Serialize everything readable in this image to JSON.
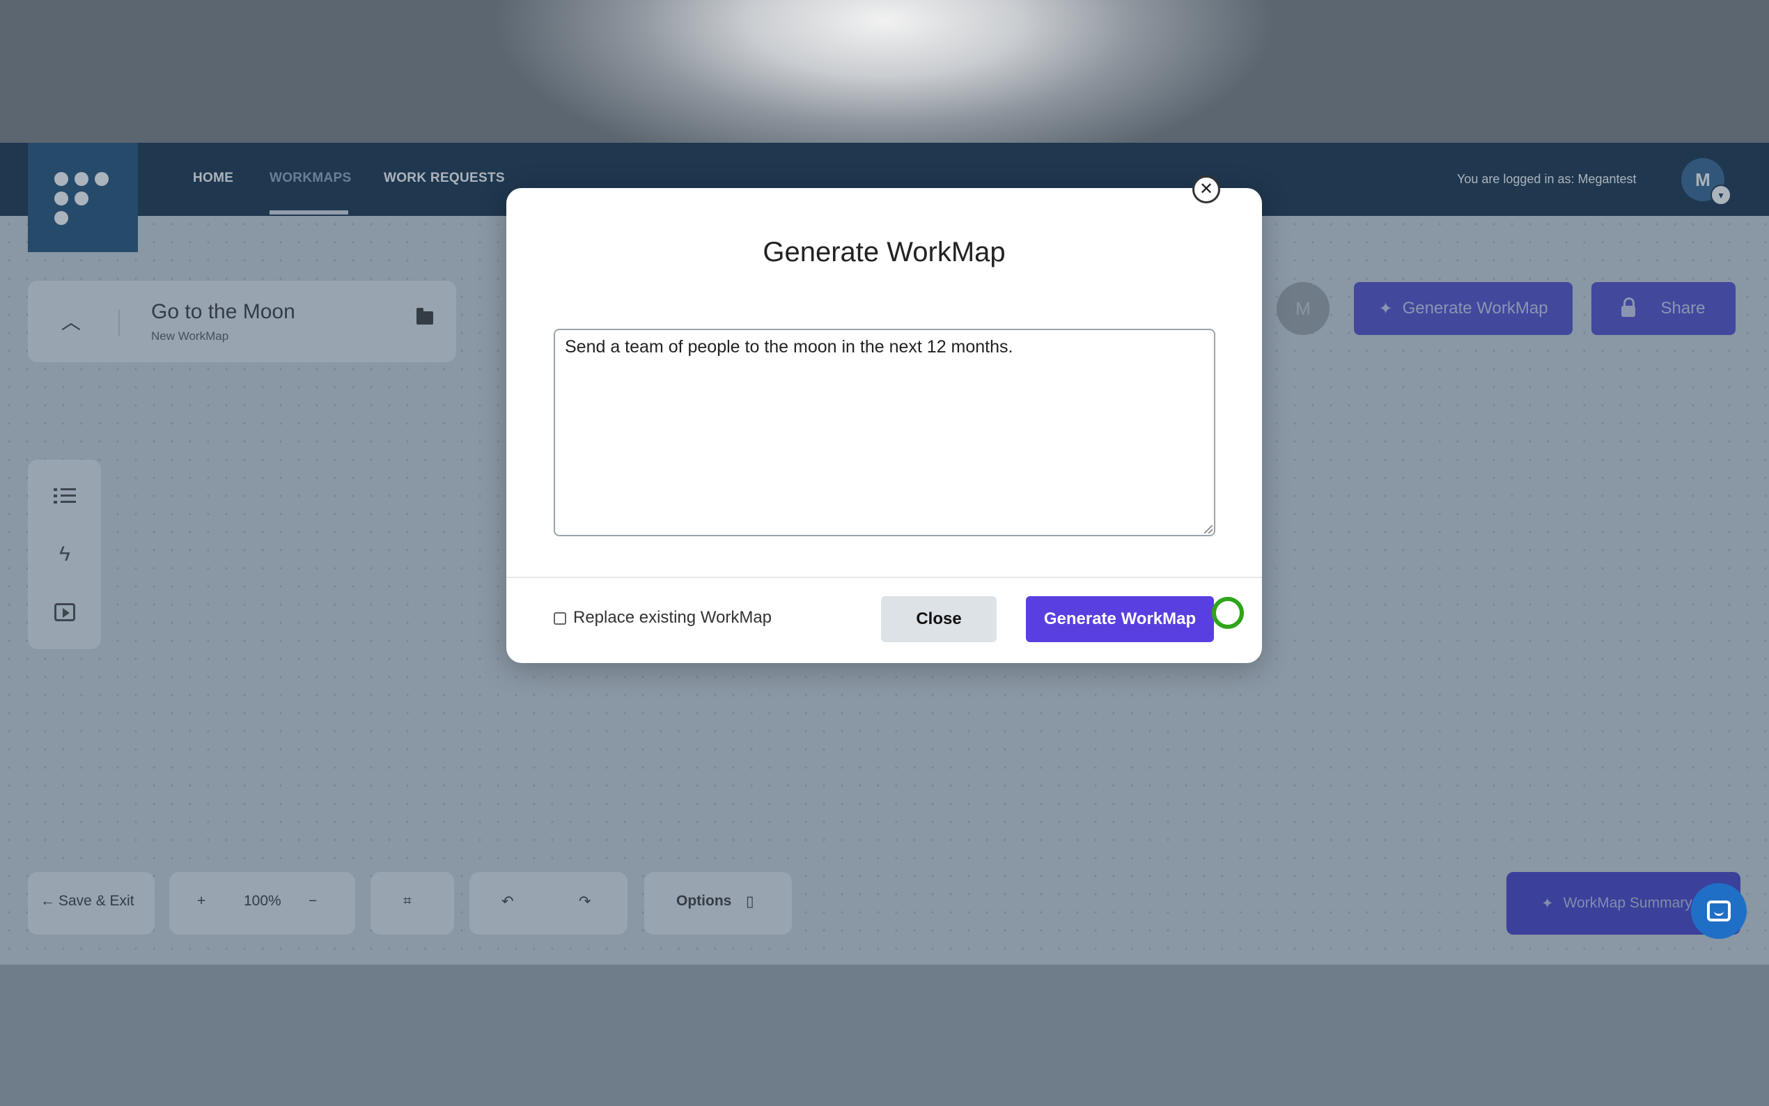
{
  "navbar": {
    "links": [
      "HOME",
      "WORKMAPS",
      "WORK REQUESTS"
    ],
    "login_text": "You are logged in as: Megantest",
    "avatar_initial": "M"
  },
  "workmap": {
    "title": "Go to the Moon",
    "subtitle": "New WorkMap"
  },
  "header_actions": {
    "collaborator_initial": "M",
    "generate_label": "Generate WorkMap",
    "share_label": "Share"
  },
  "bottom_toolbar": {
    "save_exit_label": "Save & Exit",
    "zoom_in": "+",
    "zoom_level": "100%",
    "zoom_out": "−",
    "options_label": "Options",
    "summary_label": "WorkMap Summary"
  },
  "modal": {
    "title": "Generate WorkMap",
    "prompt_value": "Send a team of people to the moon in the next 12 months.",
    "replace_label": "Replace existing WorkMap",
    "replace_checked": false,
    "close_label": "Close",
    "generate_label": "Generate WorkMap"
  },
  "colors": {
    "navbar": "#0f2a44",
    "accent": "#5a3fe0",
    "click_marker": "#2ea51a"
  }
}
